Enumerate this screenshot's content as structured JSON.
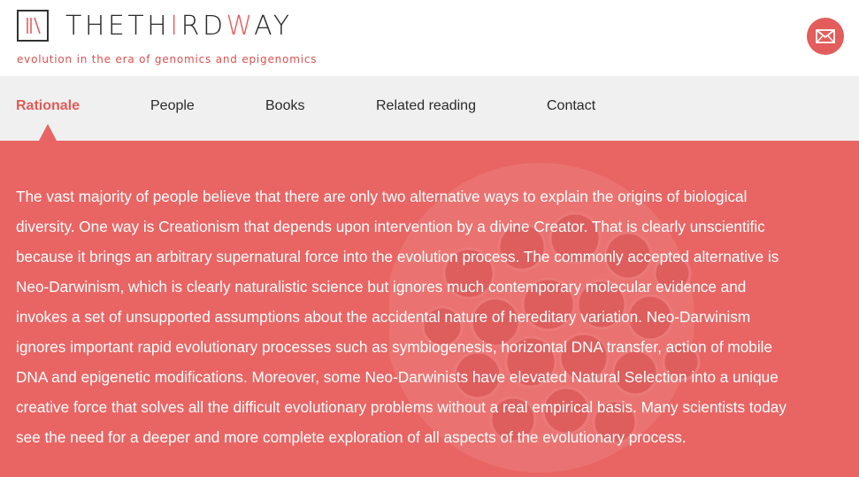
{
  "header": {
    "brand_prefix": "THETH",
    "brand_accent": "I",
    "brand_mid": "RD",
    "brand_accent2": "W",
    "brand_suffix": "AY",
    "tagline": "evolution in the era of genomics and epigenomics",
    "mail_icon": "envelope-icon"
  },
  "nav": {
    "items": [
      {
        "label": "Rationale",
        "active": true
      },
      {
        "label": "People",
        "active": false
      },
      {
        "label": "Books",
        "active": false
      },
      {
        "label": "Related reading",
        "active": false
      },
      {
        "label": "Contact",
        "active": false
      }
    ]
  },
  "main": {
    "paragraph": "The vast majority of people believe that there are only two alternative ways to explain the origins of biological diversity. One way is Creationism that depends upon intervention by a divine Creator. That is clearly unscientific because it brings an arbitrary supernatural force into the evolution process. The commonly accepted alternative is Neo-Darwinism, which is clearly naturalistic science but ignores much contemporary molecular evidence and invokes a set of unsupported assumptions about the accidental nature of hereditary variation. Neo-Darwinism ignores important rapid evolutionary processes such as symbiogenesis, horizontal DNA transfer, action of mobile DNA and epigenetic modifications. Moreover, some Neo-Darwinists have elevated Natural Selection into a unique creative force that solves all the difficult evolutionary problems without a real empirical basis. Many scientists today see the need for a deeper and more complete exploration of all aspects of the evolutionary process."
  },
  "colors": {
    "accent": "#e86564",
    "nav_bg": "#f0f0f0",
    "active_nav": "#e05a58"
  }
}
